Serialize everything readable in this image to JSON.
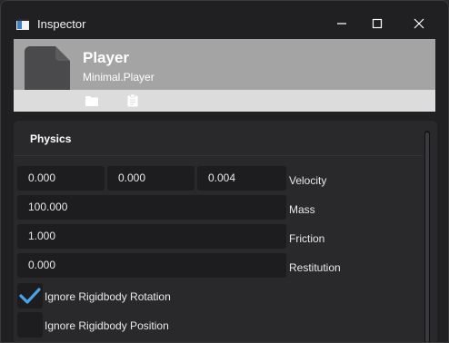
{
  "window": {
    "title": "Inspector"
  },
  "header": {
    "name": "Player",
    "type": "Minimal.Player"
  },
  "section": {
    "title": "Physics"
  },
  "fields": {
    "velocity": {
      "x": "0.000",
      "y": "0.000",
      "z": "0.004",
      "label": "Velocity"
    },
    "mass": {
      "value": "100.000",
      "label": "Mass"
    },
    "friction": {
      "value": "1.000",
      "label": "Friction"
    },
    "restitution": {
      "value": "0.000",
      "label": "Restitution"
    }
  },
  "checkboxes": {
    "ignore_rotation": {
      "label": "Ignore Rigidbody Rotation",
      "checked": true
    },
    "ignore_position": {
      "label": "Ignore Rigidbody Position",
      "checked": false
    }
  },
  "colors": {
    "accent": "#4aa3e6",
    "header_bg": "#a4a4a4",
    "toolbar_bg": "#dcdcdc",
    "field_bg": "#1d1d1f"
  },
  "icons": {
    "app": "inspector-app-icon",
    "minimize": "minimize-icon",
    "maximize": "maximize-icon",
    "close": "close-icon",
    "file": "file-icon",
    "folder": "folder-icon",
    "clipboard": "clipboard-icon",
    "check": "checkmark-icon"
  }
}
